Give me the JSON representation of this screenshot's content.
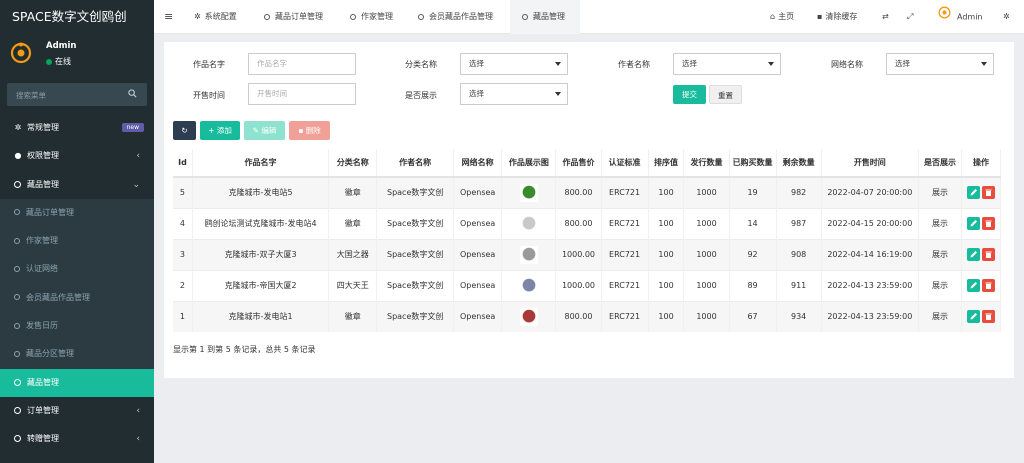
{
  "sidebar": {
    "brand": "SPACE数字文创鸥创",
    "user_name": "Admin",
    "user_status": "在线",
    "search_placeholder": "搜索菜单",
    "items": [
      {
        "label": "常规管理",
        "badge": "new"
      },
      {
        "label": "权限管理"
      },
      {
        "label": "藏品管理"
      },
      {
        "label": "藏品订单管理"
      },
      {
        "label": "作家管理"
      },
      {
        "label": "认证网络"
      },
      {
        "label": "会员藏品作品管理"
      },
      {
        "label": "发售日历"
      },
      {
        "label": "藏品分区管理"
      },
      {
        "label": "藏品管理"
      },
      {
        "label": "订单管理"
      },
      {
        "label": "转赠管理"
      }
    ]
  },
  "topbar": {
    "tabs": [
      "系统配置",
      "藏品订单管理",
      "作家管理",
      "会员藏品作品管理",
      "藏品管理"
    ],
    "home": "主页",
    "clear_cache": "清除缓存",
    "admin": "Admin"
  },
  "filters": {
    "name_label": "作品名字",
    "name_placeholder": "作品名字",
    "category_label": "分类名称",
    "category_value": "选择",
    "author_label": "作者名称",
    "author_value": "选择",
    "network_label": "网络名称",
    "network_value": "选择",
    "sale_time_label": "开售时间",
    "sale_time_placeholder": "开售时间",
    "display_label": "是否展示",
    "display_value": "选择",
    "submit": "提交",
    "reset": "重置"
  },
  "toolbar": {
    "add": "添加",
    "edit": "编辑",
    "delete": "删除"
  },
  "table": {
    "headers": [
      "Id",
      "作品名字",
      "分类名称",
      "作者名称",
      "网络名称",
      "作品展示图",
      "作品售价",
      "认证标准",
      "排序值",
      "发行数量",
      "已购买数量",
      "剩余数量",
      "开售时间",
      "是否展示",
      "操作"
    ],
    "rows": [
      {
        "id": "5",
        "name": "克隆城市-发电站5",
        "category": "徽章",
        "author": "Space数字文创",
        "network": "Opensea",
        "thumb": "#3a8a2e",
        "price": "800.00",
        "standard": "ERC721",
        "sort": "100",
        "issued": "1000",
        "bought": "19",
        "remain": "982",
        "time": "2022-04-07 20:00:00",
        "show": "展示"
      },
      {
        "id": "4",
        "name": "鸥创论坛测试克隆城市-发电站4",
        "category": "徽章",
        "author": "Space数字文创",
        "network": "Opensea",
        "thumb": "#c9c9c9",
        "price": "800.00",
        "standard": "ERC721",
        "sort": "100",
        "issued": "1000",
        "bought": "14",
        "remain": "987",
        "time": "2022-04-15 20:00:00",
        "show": "展示"
      },
      {
        "id": "3",
        "name": "克隆城市-双子大厦3",
        "category": "大国之器",
        "author": "Space数字文创",
        "network": "Opensea",
        "thumb": "#9a9a9a",
        "price": "1000.00",
        "standard": "ERC721",
        "sort": "100",
        "issued": "1000",
        "bought": "92",
        "remain": "908",
        "time": "2022-04-14 16:19:00",
        "show": "展示"
      },
      {
        "id": "2",
        "name": "克隆城市-帝国大厦2",
        "category": "四大天王",
        "author": "Space数字文创",
        "network": "Opensea",
        "thumb": "#7d86a8",
        "price": "1000.00",
        "standard": "ERC721",
        "sort": "100",
        "issued": "1000",
        "bought": "89",
        "remain": "911",
        "time": "2022-04-13 23:59:00",
        "show": "展示"
      },
      {
        "id": "1",
        "name": "克隆城市-发电站1",
        "category": "徽章",
        "author": "Space数字文创",
        "network": "Opensea",
        "thumb": "#a83a3a",
        "price": "800.00",
        "standard": "ERC721",
        "sort": "100",
        "issued": "1000",
        "bought": "67",
        "remain": "934",
        "time": "2022-04-13 23:59:00",
        "show": "展示"
      }
    ]
  },
  "footer_text": "显示第 1 到第 5 条记录，总共 5 条记录",
  "colors": {
    "accent": "#18bc9c",
    "sidebar": "#222d32",
    "danger": "#e74c3c",
    "dark_button": "#2c3e50"
  }
}
